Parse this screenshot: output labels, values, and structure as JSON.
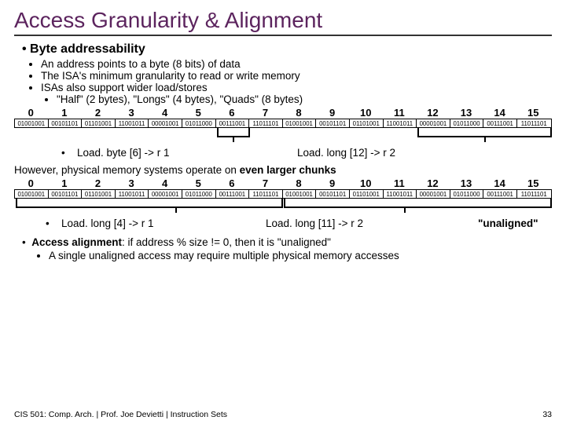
{
  "title": "Access Granularity & Alignment",
  "sec1_heading": "Byte addressability",
  "sec1_b1": "An address points to a byte (8 bits) of data",
  "sec1_b2": "The ISA's minimum granularity to read or write memory",
  "sec1_b3": "ISAs also support wider load/stores",
  "sec1_b3a": "\"Half\" (2 bytes), \"Longs\" (4 bytes), \"Quads\" (8 bytes)",
  "nums": [
    "0",
    "1",
    "2",
    "3",
    "4",
    "5",
    "6",
    "7",
    "8",
    "9",
    "10",
    "11",
    "12",
    "13",
    "14",
    "15"
  ],
  "bytes": [
    "01001001",
    "00101101",
    "01101001",
    "11001011",
    "00001001",
    "01011000",
    "00111001",
    "11011101",
    "01001001",
    "00101101",
    "01101001",
    "11001011",
    "00001001",
    "01011000",
    "00111001",
    "11011101"
  ],
  "load1a_bullet": "•",
  "load1a": "Load. byte [6] -> r 1",
  "load1b": "Load. long [12] -> r 2",
  "para2": "However, physical memory systems operate on ",
  "para2b": "even larger chunks",
  "load2a_bullet": "•",
  "load2a": "Load. long [4] -> r 1",
  "load2b": "Load. long [11] -> r 2",
  "unaligned": "\"unaligned\"",
  "align_bullet": "•",
  "align_label": "Access alignment",
  "align_text": ": if address % size != 0, then it is \"unaligned\"",
  "align_sub": "A single unaligned access may require multiple physical memory accesses",
  "footer_left": "CIS 501: Comp. Arch.  |  Prof. Joe Devietti  |  Instruction Sets",
  "footer_right": "33"
}
